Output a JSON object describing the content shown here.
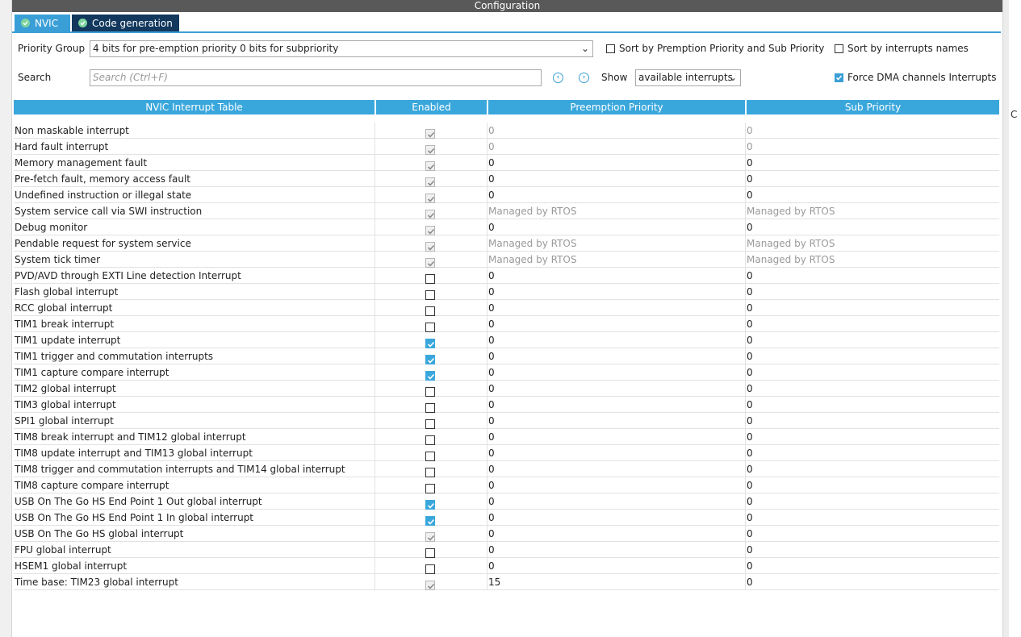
{
  "window": {
    "title": "Configuration"
  },
  "tabs": [
    {
      "label": "NVIC",
      "active": true
    },
    {
      "label": "Code generation",
      "active": false
    }
  ],
  "controls": {
    "priority_group_label": "Priority Group",
    "priority_group_value": "4 bits for pre-emption priority 0 bits for subpriority",
    "sort_premption_label": "Sort by Premption Priority and Sub Priority",
    "sort_premption_checked": false,
    "sort_names_label": "Sort by interrupts names",
    "sort_names_checked": false,
    "search_label": "Search",
    "search_placeholder": "Search (Ctrl+F)",
    "show_label": "Show",
    "show_value": "available interrupts",
    "force_dma_label": "Force DMA channels Interrupts",
    "force_dma_checked": true
  },
  "table": {
    "headers": [
      "NVIC Interrupt Table",
      "Enabled",
      "Preemption Priority",
      "Sub Priority"
    ],
    "rows": [
      {
        "name": "Non maskable interrupt",
        "enabled": true,
        "editable": false,
        "pre": "0",
        "sub": "0",
        "greyed": true
      },
      {
        "name": "Hard fault interrupt",
        "enabled": true,
        "editable": false,
        "pre": "0",
        "sub": "0",
        "greyed": true
      },
      {
        "name": "Memory management fault",
        "enabled": true,
        "editable": false,
        "pre": "0",
        "sub": "0",
        "greyed": false
      },
      {
        "name": "Pre-fetch fault, memory access fault",
        "enabled": true,
        "editable": false,
        "pre": "0",
        "sub": "0",
        "greyed": false
      },
      {
        "name": "Undefined instruction or illegal state",
        "enabled": true,
        "editable": false,
        "pre": "0",
        "sub": "0",
        "greyed": false
      },
      {
        "name": "System service call via SWI instruction",
        "enabled": true,
        "editable": false,
        "pre": "Managed by RTOS",
        "sub": "Managed by RTOS",
        "greyed": true
      },
      {
        "name": "Debug monitor",
        "enabled": true,
        "editable": false,
        "pre": "0",
        "sub": "0",
        "greyed": false
      },
      {
        "name": "Pendable request for system service",
        "enabled": true,
        "editable": false,
        "pre": "Managed by RTOS",
        "sub": "Managed by RTOS",
        "greyed": true
      },
      {
        "name": "System tick timer",
        "enabled": true,
        "editable": false,
        "pre": "Managed by RTOS",
        "sub": "Managed by RTOS",
        "greyed": true
      },
      {
        "name": "PVD/AVD through EXTI Line detection Interrupt",
        "enabled": false,
        "editable": true,
        "pre": "0",
        "sub": "0",
        "greyed": false
      },
      {
        "name": "Flash global interrupt",
        "enabled": false,
        "editable": true,
        "pre": "0",
        "sub": "0",
        "greyed": false
      },
      {
        "name": "RCC global interrupt",
        "enabled": false,
        "editable": true,
        "pre": "0",
        "sub": "0",
        "greyed": false
      },
      {
        "name": "TIM1 break interrupt",
        "enabled": false,
        "editable": true,
        "pre": "0",
        "sub": "0",
        "greyed": false
      },
      {
        "name": "TIM1 update interrupt",
        "enabled": true,
        "editable": true,
        "pre": "0",
        "sub": "0",
        "greyed": false
      },
      {
        "name": "TIM1 trigger and commutation interrupts",
        "enabled": true,
        "editable": true,
        "pre": "0",
        "sub": "0",
        "greyed": false
      },
      {
        "name": "TIM1 capture compare interrupt",
        "enabled": true,
        "editable": true,
        "pre": "0",
        "sub": "0",
        "greyed": false
      },
      {
        "name": "TIM2 global interrupt",
        "enabled": false,
        "editable": true,
        "pre": "0",
        "sub": "0",
        "greyed": false
      },
      {
        "name": "TIM3 global interrupt",
        "enabled": false,
        "editable": true,
        "pre": "0",
        "sub": "0",
        "greyed": false
      },
      {
        "name": "SPI1 global interrupt",
        "enabled": false,
        "editable": true,
        "pre": "0",
        "sub": "0",
        "greyed": false
      },
      {
        "name": "TIM8 break interrupt and TIM12 global interrupt",
        "enabled": false,
        "editable": true,
        "pre": "0",
        "sub": "0",
        "greyed": false
      },
      {
        "name": "TIM8 update interrupt and TIM13 global interrupt",
        "enabled": false,
        "editable": true,
        "pre": "0",
        "sub": "0",
        "greyed": false
      },
      {
        "name": "TIM8 trigger and commutation interrupts and TIM14 global interrupt",
        "enabled": false,
        "editable": true,
        "pre": "0",
        "sub": "0",
        "greyed": false
      },
      {
        "name": "TIM8 capture compare interrupt",
        "enabled": false,
        "editable": true,
        "pre": "0",
        "sub": "0",
        "greyed": false
      },
      {
        "name": "USB On The Go HS End Point 1 Out global interrupt",
        "enabled": true,
        "editable": true,
        "pre": "0",
        "sub": "0",
        "greyed": false
      },
      {
        "name": "USB On The Go HS End Point 1 In global interrupt",
        "enabled": true,
        "editable": true,
        "pre": "0",
        "sub": "0",
        "greyed": false
      },
      {
        "name": "USB On The Go HS global interrupt",
        "enabled": true,
        "editable": false,
        "pre": "0",
        "sub": "0",
        "greyed": false
      },
      {
        "name": "FPU global interrupt",
        "enabled": false,
        "editable": true,
        "pre": "0",
        "sub": "0",
        "greyed": false
      },
      {
        "name": "HSEM1 global interrupt",
        "enabled": false,
        "editable": true,
        "pre": "0",
        "sub": "0",
        "greyed": false
      },
      {
        "name": "Time base: TIM23 global interrupt",
        "enabled": true,
        "editable": false,
        "pre": "15",
        "sub": "0",
        "greyed": false
      }
    ]
  },
  "edge_text": "C"
}
